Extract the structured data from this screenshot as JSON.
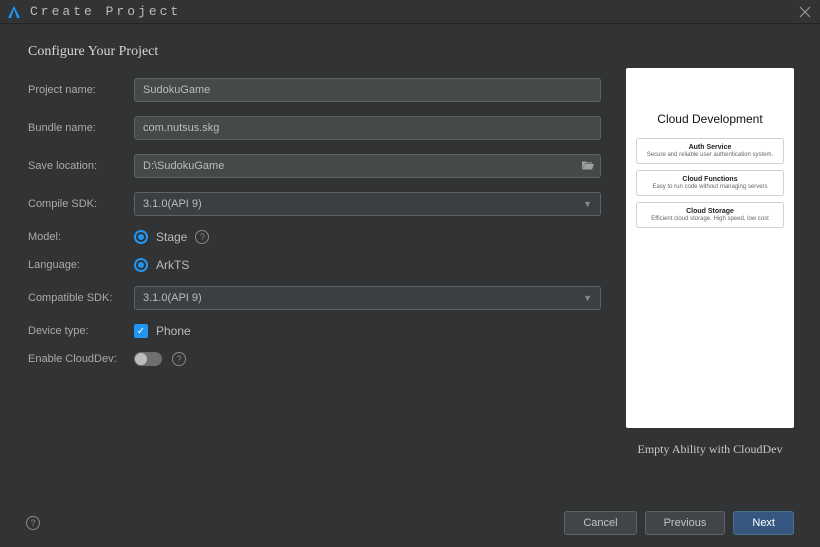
{
  "window": {
    "title": "Create Project"
  },
  "heading": "Configure Your Project",
  "labels": {
    "project_name": "Project name:",
    "bundle_name": "Bundle name:",
    "save_location": "Save location:",
    "compile_sdk": "Compile SDK:",
    "model": "Model:",
    "language": "Language:",
    "compatible_sdk": "Compatible SDK:",
    "device_type": "Device type:",
    "enable_clouddev": "Enable CloudDev:"
  },
  "values": {
    "project_name": "SudokuGame",
    "bundle_name": "com.nutsus.skg",
    "save_location": "D:\\SudokuGame",
    "compile_sdk": "3.1.0(API 9)",
    "model": "Stage",
    "language": "ArkTS",
    "compatible_sdk": "3.1.0(API 9)",
    "device_type": "Phone"
  },
  "preview": {
    "title": "Cloud Development",
    "cards": [
      {
        "title": "Auth Service",
        "sub": "Secure and reliable user authentication system."
      },
      {
        "title": "Cloud Functions",
        "sub": "Easy to run code without managing servers"
      },
      {
        "title": "Cloud Storage",
        "sub": "Efficient cloud storage. High speed, low cost"
      }
    ],
    "caption": "Empty Ability with CloudDev"
  },
  "footer": {
    "cancel": "Cancel",
    "previous": "Previous",
    "next": "Next"
  }
}
